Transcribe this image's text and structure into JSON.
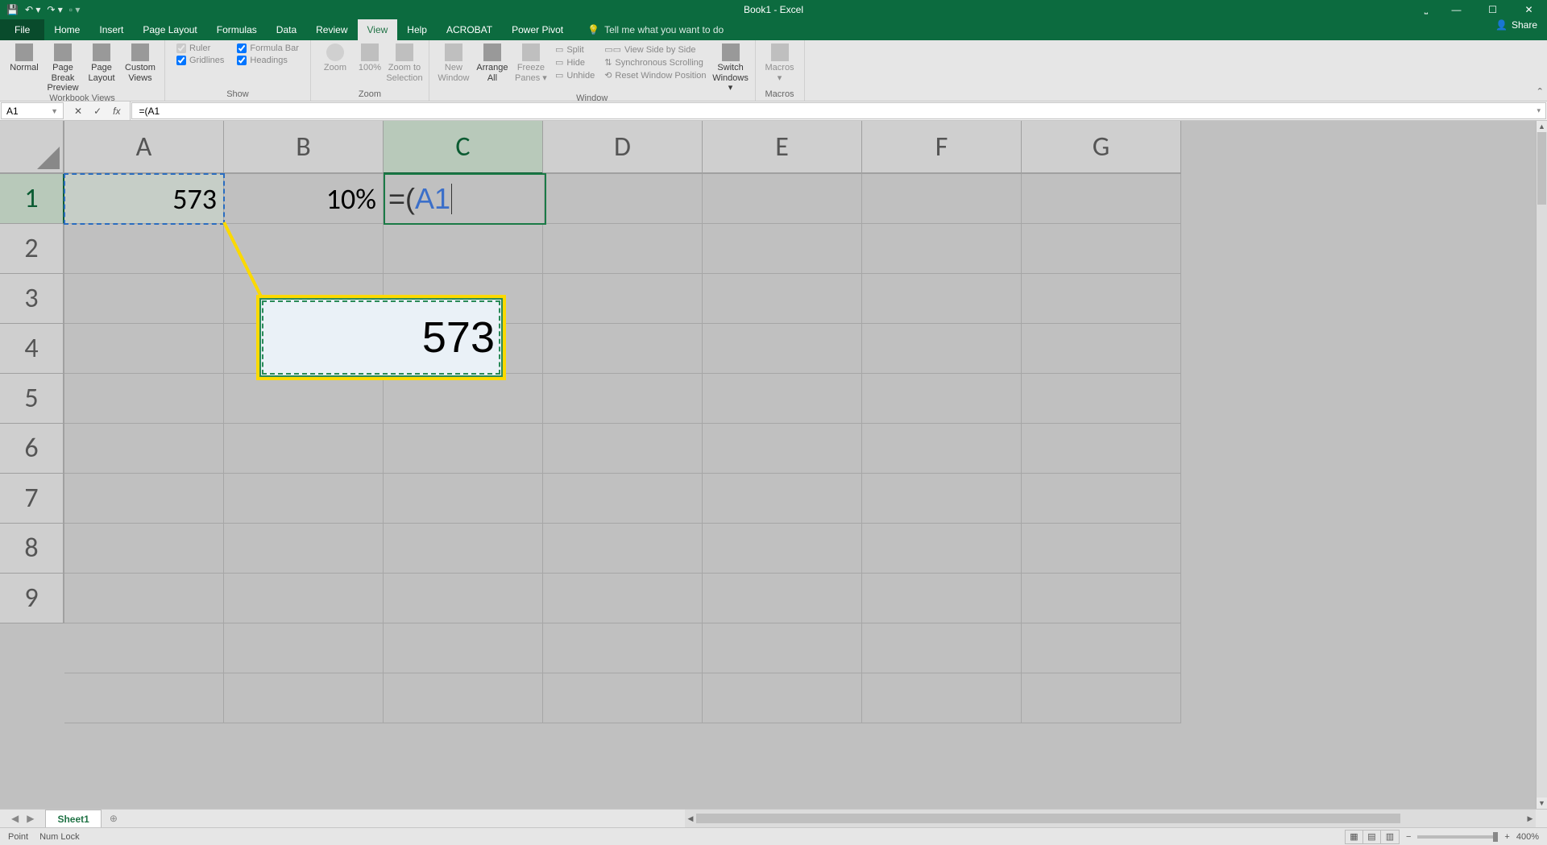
{
  "title": "Book1 - Excel",
  "qat": {
    "save": "💾",
    "undo": "↶",
    "redo": "↷"
  },
  "tabs": [
    "File",
    "Home",
    "Insert",
    "Page Layout",
    "Formulas",
    "Data",
    "Review",
    "View",
    "Help",
    "ACROBAT",
    "Power Pivot"
  ],
  "active_tab": "View",
  "tell_me_placeholder": "Tell me what you want to do",
  "share_label": "Share",
  "ribbon": {
    "workbook_views": {
      "label": "Workbook Views",
      "normal": "Normal",
      "page_break": "Page Break\nPreview",
      "page_layout": "Page\nLayout",
      "custom": "Custom\nViews"
    },
    "show": {
      "label": "Show",
      "ruler": "Ruler",
      "formula_bar": "Formula Bar",
      "gridlines": "Gridlines",
      "headings": "Headings"
    },
    "zoom": {
      "label": "Zoom",
      "zoom": "Zoom",
      "hundred": "100%",
      "selection": "Zoom to\nSelection"
    },
    "window": {
      "label": "Window",
      "new_window": "New\nWindow",
      "arrange": "Arrange\nAll",
      "freeze": "Freeze\nPanes ▾",
      "split": "Split",
      "hide": "Hide",
      "unhide": "Unhide",
      "side_by_side": "View Side by Side",
      "sync_scroll": "Synchronous Scrolling",
      "reset_pos": "Reset Window Position",
      "switch": "Switch\nWindows ▾"
    },
    "macros": {
      "label": "Macros",
      "macros": "Macros\n▾"
    }
  },
  "name_box": "A1",
  "formula": "=(A1",
  "columns": [
    "A",
    "B",
    "C",
    "D",
    "E",
    "F",
    "G"
  ],
  "rows": [
    "1",
    "2",
    "3",
    "4",
    "5",
    "6",
    "7",
    "8",
    "9"
  ],
  "cells": {
    "A1": "573",
    "B1": "10%",
    "C1_parts": {
      "eq": "=",
      "paren": "(",
      "ref": "A1"
    }
  },
  "callout_value": "573",
  "sheet": {
    "name": "Sheet1"
  },
  "status": {
    "mode": "Point",
    "numlock": "Num Lock",
    "zoom": "400%"
  }
}
